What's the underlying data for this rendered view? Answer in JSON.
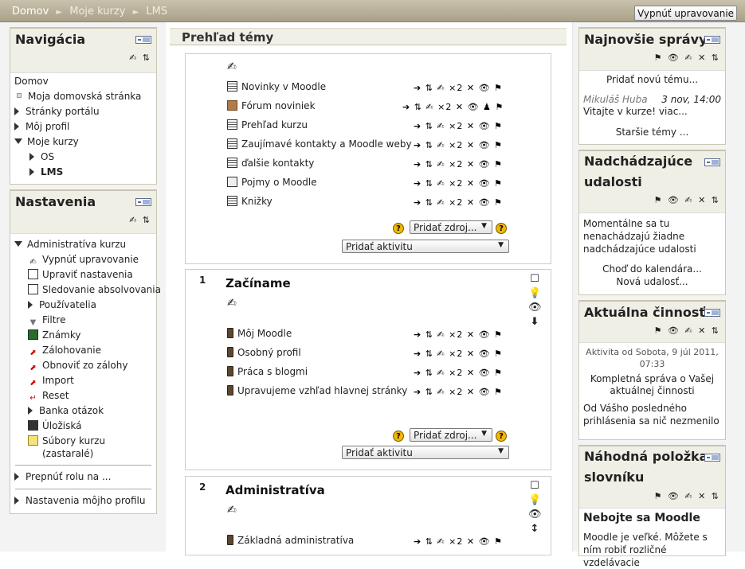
{
  "breadcrumb": {
    "home": "Domov",
    "sep": "►",
    "courses": "Moje kurzy",
    "current": "LMS"
  },
  "edit_button": "Vypnúť upravovanie",
  "navigation": {
    "title": "Navigácia",
    "home": "Domov",
    "items": [
      "Moja domovská stránka",
      "Stránky portálu",
      "Môj profil",
      "Moje kurzy",
      "OS",
      "LMS"
    ]
  },
  "settings": {
    "title": "Nastavenia",
    "admin": "Administratíva kurzu",
    "items": [
      "Vypnúť upravovanie",
      "Upraviť nastavenia",
      "Sledovanie absolvovania",
      "Používatelia",
      "Filtre",
      "Známky",
      "Zálohovanie",
      "Obnoviť zo zálohy",
      "Import",
      "Reset",
      "Banka otázok",
      "Úložiská",
      "Súbory kurzu",
      "(zastaralé)"
    ],
    "switch_role": "Prepnúť rolu na ...",
    "profile": "Nastavenia môjho profilu"
  },
  "main": {
    "title": "Prehľad témy",
    "section0": [
      "Novinky v Moodle",
      "Fórum noviniek",
      "Prehľad kurzu",
      "Zaujímavé kontakty a Moodle weby",
      "ďalšie kontakty",
      "Pojmy o Moodle",
      "Knižky"
    ],
    "add_resource": "Pridať zdroj...",
    "add_activity": "Pridať aktivitu",
    "section1": {
      "num": "1",
      "title": "Začíname",
      "items": [
        "Môj Moodle",
        "Osobný profil",
        "Práca s blogmi",
        "Upravujeme vzhľad hlavnej stránky"
      ]
    },
    "section2": {
      "num": "2",
      "title": "Administratíva",
      "items": [
        "Základná administratíva"
      ]
    },
    "edit_icons": "➔ ⇅ ✍ ×2 ✕ 👁 ⚑",
    "edit_icons_forum": "➔ ⇅ ✍ ×2 ✕ 👁 ♟ ⚑"
  },
  "news": {
    "title": "Najnovšie správy",
    "add": "Pridať novú tému...",
    "author": "Mikuláš Huba",
    "date": "3 nov, 14:00",
    "msg": "Vitajte v kurze! viac...",
    "older": "Staršie témy ..."
  },
  "events": {
    "title1": "Nadchádzajúce",
    "title2": "udalosti",
    "text": "Momentálne sa tu nenachádzajú žiadne nadchádzajúce udalosti",
    "calendar": "Choď do kalendára...",
    "new": "Nová udalosť..."
  },
  "activity": {
    "title": "Aktuálna činnosť",
    "since": "Aktivita od Sobota, 9 júl 2011, 07:33",
    "full": "Kompletná správa o Vašej aktuálnej činnosti",
    "nothing": "Od Vášho posledného prihlásenia sa nič nezmenilo"
  },
  "glossary": {
    "title1": "Náhodná položka",
    "title2": "slovníku",
    "entry": "Nebojte sa Moodle",
    "text": "Moodle je veľké. Môžete s ním robiť rozličné vzdelávacie"
  },
  "block_icons": "⚑ 👁 ✍ ✕ ⇅",
  "block_icons_small": "✍ ⇅"
}
